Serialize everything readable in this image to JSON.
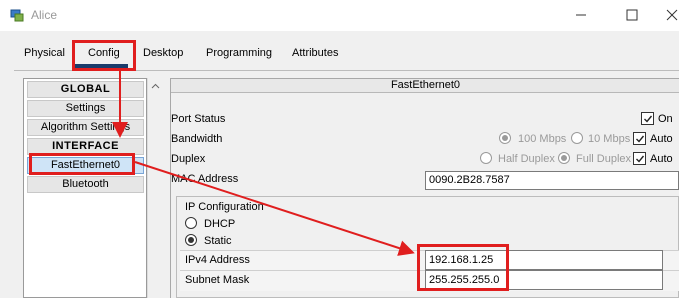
{
  "window": {
    "title": "Alice",
    "app_icon": "packet-tracer-icon"
  },
  "tabs": [
    {
      "label": "Physical"
    },
    {
      "label": "Config"
    },
    {
      "label": "Desktop"
    },
    {
      "label": "Programming"
    },
    {
      "label": "Attributes"
    }
  ],
  "active_tab": "Config",
  "sidebar": {
    "global": "GLOBAL",
    "settings": "Settings",
    "algorithm_settings": "Algorithm Settings",
    "interface": "INTERFACE",
    "fastethernet0": "FastEthernet0",
    "bluetooth": "Bluetooth"
  },
  "panel": {
    "header": "FastEthernet0",
    "port_status": {
      "label": "Port Status",
      "on_label": "On",
      "on_checked": true
    },
    "bandwidth": {
      "label": "Bandwidth",
      "opt_100": "100 Mbps",
      "opt_10": "10 Mbps",
      "auto_label": "Auto",
      "auto_checked": true
    },
    "duplex": {
      "label": "Duplex",
      "half": "Half Duplex",
      "full": "Full Duplex",
      "auto_label": "Auto",
      "auto_checked": true
    },
    "mac": {
      "label": "MAC Address",
      "value": "0090.2B28.7587"
    },
    "ip_config": {
      "title": "IP Configuration",
      "dhcp": "DHCP",
      "static": "Static",
      "selected": "Static",
      "ipv4_label": "IPv4 Address",
      "ipv4_value": "192.168.1.25",
      "mask_label": "Subnet Mask",
      "mask_value": "255.255.255.0"
    }
  },
  "colors": {
    "annotation": "#e01e1e",
    "tab_underline": "#1a3b6b",
    "selected_item": "#cfe4f7"
  }
}
